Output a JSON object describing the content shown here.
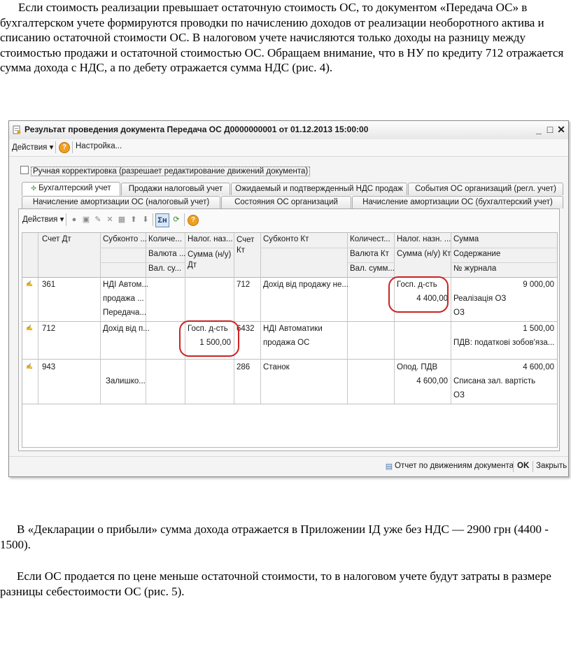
{
  "text": {
    "p1": "Если стоимость реализации превышает остаточную стоимость ОС, то документом «Передача ОС» в бухгалтерском учете формируются проводки по начислению доходов от реализации необоротного актива и списанию остаточной стоимости ОС. В налоговом учете начисляются только доходы на разницу между стоимостью продажи и остаточной стоимостью ОС. Обращаем внимание, что в НУ по кредиту 712 отражается сумма дохода с НДС, а по дебету отражается сумма НДС (рис. 4).",
    "p2": "В «Декларации о прибыли» сумма дохода отражается в Приложении ІД уже без НДС — 2900 грн (4400 - 1500).",
    "p3": "Если ОС продается по цене меньше остаточной стоимости, то в налоговом учете будут затраты в размере разницы себестоимости ОС (рис. 5)."
  },
  "window": {
    "title": "Результат проведения документа Передача ОС Д0000000001 от 01.12.2013 15:00:00",
    "buttons": {
      "minimize": "_",
      "maximize": "□",
      "close": "✕"
    },
    "menu": {
      "actions": "Действия ▾",
      "help": "?",
      "settings": "Настройка..."
    },
    "checkbox_label": "Ручная корректировка (разрешает редактирование движений документа)",
    "tabs_row1": [
      "Бухгалтерский учет",
      "Продажи налоговый учет",
      "Ожидаемый и подтвержденный НДС продаж",
      "События ОС организаций (регл. учет)"
    ],
    "tabs_row2": [
      "Начисление амортизации ОС (налоговый учет)",
      "Состояния ОС организаций",
      "Начисление амортизации ОС (бухгалтерский учет)"
    ],
    "toolbar": {
      "actions": "Действия ▾",
      "sum_icon": "Σн"
    },
    "columns": {
      "schet_dt": "Счет Дт",
      "subkonto_dt": "Субконто ...",
      "kol_1": "Количе...",
      "valyuta_dt": "Валюта ...",
      "val_sum_dt": "Вал. су...",
      "nalog_naz_dt": "Налог. наз...",
      "summa_nu_dt": "Сумма (н/у) Дт",
      "schet_kt": "Счет Кт",
      "subkonto_kt": "Субконто Кт",
      "kol_2": "Количест...",
      "valyuta_kt": "Валюта Кт",
      "val_sum_kt": "Вал. сумм...",
      "nalog_naz_kt": "Налог. назн. ...",
      "summa_nu_kt": "Сумма (н/у) Кт",
      "summa": "Сумма",
      "soderzhanie": "Содержание",
      "zhurnal": "№ журнала"
    },
    "rows": [
      {
        "schet_dt": "361",
        "sub_dt": [
          "НДІ Автом...",
          "продажа ...",
          "Передача..."
        ],
        "nalog_dt": "",
        "summa_nu_dt": "",
        "schet_kt": "712",
        "sub_kt": [
          "Дохід від продажу не..."
        ],
        "nalog_kt": "Госп. д-сть",
        "summa_nu_kt": "4 400,00",
        "summa": "9 000,00",
        "soderzh": "Реалізація ОЗ",
        "zhurnal": "ОЗ"
      },
      {
        "schet_dt": "712",
        "sub_dt": [
          "Дохід від п..."
        ],
        "nalog_dt": "Госп. д-сть",
        "summa_nu_dt": "1 500,00",
        "schet_kt": "6432",
        "sub_kt": [
          "НДІ Автоматики",
          "продажа ОС"
        ],
        "nalog_kt": "",
        "summa_nu_kt": "",
        "summa": "1 500,00",
        "soderzh": "ПДВ: податкові зобов'яза...",
        "zhurnal": ""
      },
      {
        "schet_dt": "943",
        "sub_dt": [
          "",
          "Залишко..."
        ],
        "nalog_dt": "",
        "summa_nu_dt": "",
        "schet_kt": "286",
        "sub_kt": [
          "Станок"
        ],
        "nalog_kt": "Опод. ПДВ",
        "summa_nu_kt": "4 600,00",
        "summa": "4 600,00",
        "soderzh": "Списана зал. вартість",
        "zhurnal": "ОЗ"
      }
    ],
    "bottom": {
      "report": "Отчет по движениям документа",
      "ok": "OK",
      "close": "Закрыть"
    }
  }
}
